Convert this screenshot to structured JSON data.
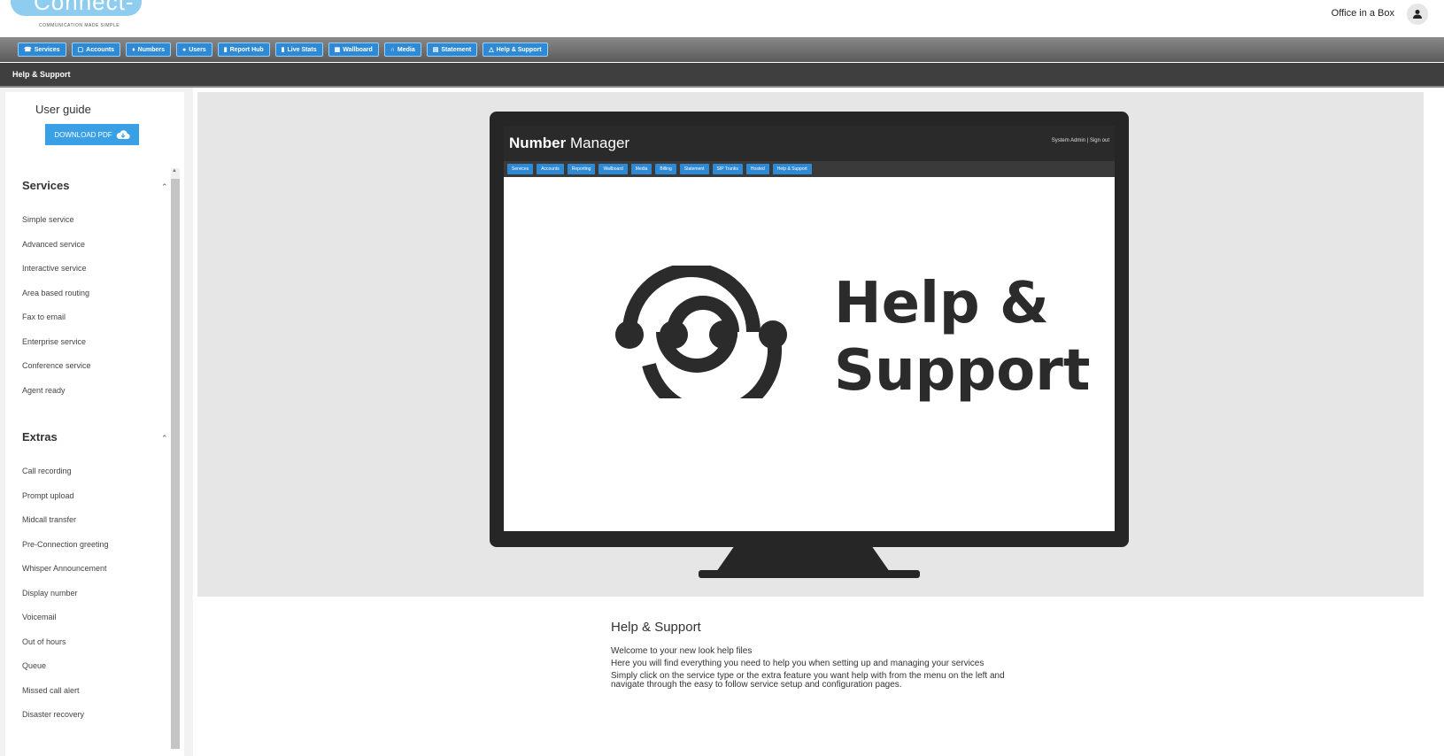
{
  "header": {
    "logo_text": "Connect-It",
    "logo_tagline": "COMMUNICATION MADE SIMPLE",
    "user_name": "Office in a Box",
    "user_icon": "person-icon"
  },
  "nav": {
    "items": [
      {
        "label": "Services",
        "icon": "phone-icon"
      },
      {
        "label": "Accounts",
        "icon": "folder-icon"
      },
      {
        "label": "Numbers",
        "icon": "pin-icon"
      },
      {
        "label": "Users",
        "icon": "person-icon"
      },
      {
        "label": "Report Hub",
        "icon": "chart-icon"
      },
      {
        "label": "Live Stats",
        "icon": "chart-icon"
      },
      {
        "label": "Wallboard",
        "icon": "grid-icon"
      },
      {
        "label": "Media",
        "icon": "headphones-icon"
      },
      {
        "label": "Statement",
        "icon": "document-icon"
      },
      {
        "label": "Help & Support",
        "icon": "warning-icon"
      }
    ]
  },
  "breadcrumb": "Help & Support",
  "sidebar": {
    "guide_title": "User guide",
    "download_label": "DOWNLOAD PDF",
    "sections": [
      {
        "title": "Services",
        "items": [
          "Simple service",
          "Advanced service",
          "Interactive service",
          "Area based routing",
          "Fax to email",
          "Enterprise service",
          "Conference service",
          "Agent ready"
        ]
      },
      {
        "title": "Extras",
        "items": [
          "Call recording",
          "Prompt upload",
          "Midcall transfer",
          "Pre-Connection greeting",
          "Whisper Announcement",
          "Display number",
          "Voicemail",
          "Out of hours",
          "Queue",
          "Missed call alert",
          "Disaster recovery"
        ]
      }
    ]
  },
  "hero": {
    "app_title_bold": "Number",
    "app_title_rest": "Manager",
    "app_user": "System Admin | Sign out",
    "nav": [
      "Services",
      "Accounts",
      "Reporting",
      "Wallboard",
      "Media",
      "Billing",
      "Statement",
      "SIP Trunks",
      "Hosted",
      "Help & Support"
    ],
    "screen_heading_line1": "Help &",
    "screen_heading_line2": "Support"
  },
  "content": {
    "title": "Help & Support",
    "paragraphs": [
      "Welcome to your new look help files",
      "Here you will find everything you need to help you when setting up and managing your services",
      "Simply click on the service type or the extra feature you want help with from the menu on the left and navigate through the easy to follow service setup and configuration pages."
    ]
  },
  "colors": {
    "accent": "#2f8ad6",
    "nav_dark": "#3f3f3f",
    "logo": "#8ecdf0"
  }
}
